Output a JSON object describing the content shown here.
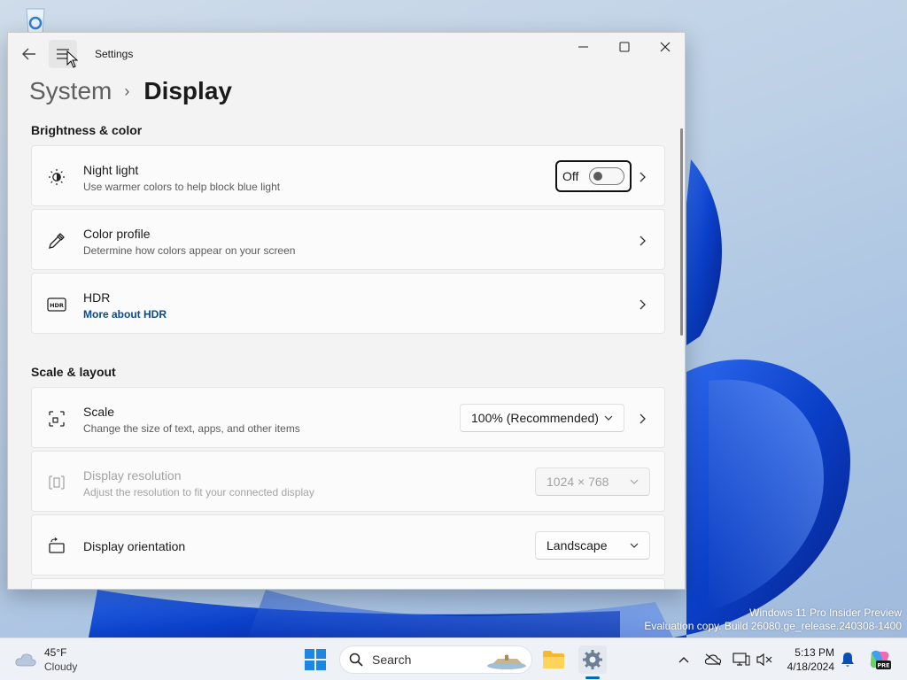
{
  "desktop": {
    "watermark_line1": "Windows 11 Pro Insider Preview",
    "watermark_line2": "Evaluation copy. Build 26080.ge_release.240308-1400"
  },
  "window": {
    "app_title": "Settings",
    "breadcrumb": {
      "parent": "System",
      "separator": "›",
      "current": "Display"
    }
  },
  "sections": {
    "brightness": "Brightness & color",
    "scale": "Scale & layout"
  },
  "cards": {
    "night_light": {
      "title": "Night light",
      "subtitle": "Use warmer colors to help block blue light",
      "toggle_state": "Off"
    },
    "color_profile": {
      "title": "Color profile",
      "subtitle": "Determine how colors appear on your screen"
    },
    "hdr": {
      "title": "HDR",
      "link": "More about HDR"
    },
    "scale": {
      "title": "Scale",
      "subtitle": "Change the size of text, apps, and other items",
      "value": "100% (Recommended)"
    },
    "resolution": {
      "title": "Display resolution",
      "subtitle": "Adjust the resolution to fit your connected display",
      "value": "1024 × 768"
    },
    "orientation": {
      "title": "Display orientation",
      "value": "Landscape"
    }
  },
  "taskbar": {
    "weather_temp": "45°F",
    "weather_cond": "Cloudy",
    "search_label": "Search",
    "time": "5:13 PM",
    "date": "4/18/2024",
    "copilot_badge": "PRE"
  },
  "colors": {
    "accent": "#0067c0",
    "link": "#0b4a8d",
    "window_bg": "#f3f3f3",
    "card_bg": "#fbfbfb"
  }
}
